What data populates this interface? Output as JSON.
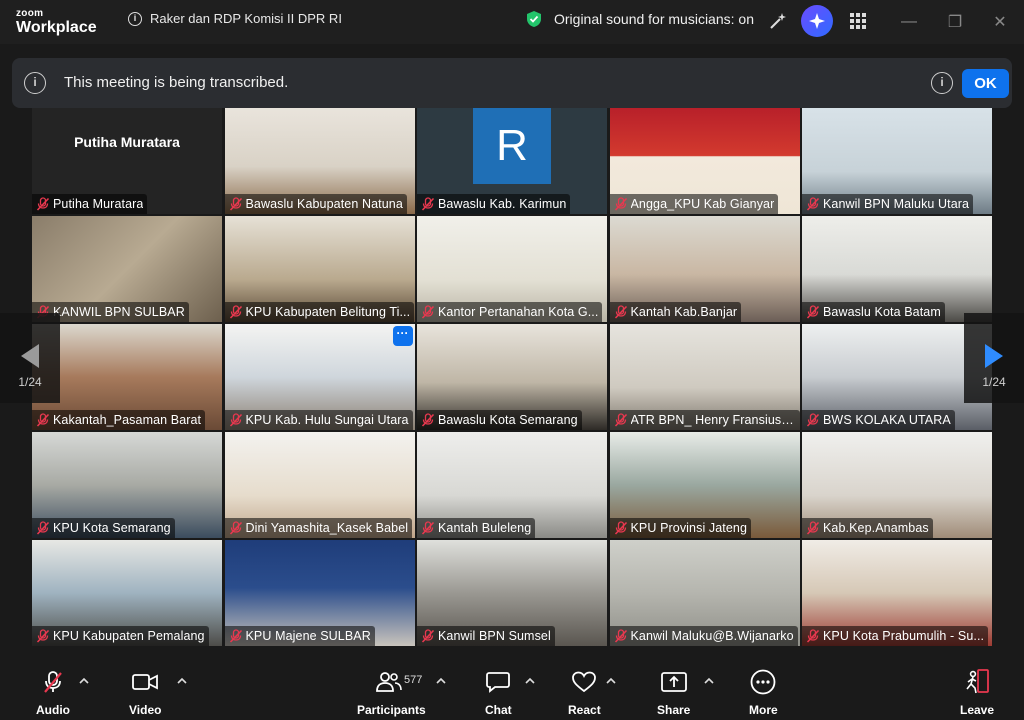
{
  "app": {
    "brand_top": "zoom",
    "brand_bottom": "Workplace"
  },
  "meeting": {
    "title": "Raker dan RDP Komisi II DPR RI"
  },
  "sound": {
    "text": "Original sound for musicians: on"
  },
  "banner": {
    "message": "This meeting is being transcribed.",
    "ok_label": "OK"
  },
  "pager": {
    "left_page": "1/24",
    "right_page": "1/24"
  },
  "tiles": [
    {
      "name": "Putiha Muratara",
      "center": "Putiha Muratara"
    },
    {
      "name": "Bawaslu Kabupaten Natuna"
    },
    {
      "name": "Bawaslu Kab. Karimun",
      "avatar": "R"
    },
    {
      "name": "Angga_KPU Kab Gianyar"
    },
    {
      "name": "Kanwil BPN Maluku Utara"
    },
    {
      "name": "KANWIL BPN SULBAR"
    },
    {
      "name": "KPU Kabupaten Belitung Ti..."
    },
    {
      "name": "Kantor Pertanahan Kota G..."
    },
    {
      "name": "Kantah Kab.Banjar"
    },
    {
      "name": "Bawaslu Kota Batam"
    },
    {
      "name": "Kakantah_Pasaman Barat"
    },
    {
      "name": "KPU Kab. Hulu Sungai Utara"
    },
    {
      "name": "Bawaslu Kota Semarang"
    },
    {
      "name": "ATR BPN_ Henry Fransius P..."
    },
    {
      "name": "BWS KOLAKA UTARA"
    },
    {
      "name": "KPU Kota Semarang"
    },
    {
      "name": "Dini Yamashita_Kasek Babel"
    },
    {
      "name": "Kantah Buleleng"
    },
    {
      "name": "KPU Provinsi Jateng"
    },
    {
      "name": "Kab.Kep.Anambas"
    },
    {
      "name": "KPU Kabupaten Pemalang"
    },
    {
      "name": "KPU Majene SULBAR"
    },
    {
      "name": "Kanwil BPN Sumsel"
    },
    {
      "name": "Kanwil Maluku@B.Wijanarko"
    },
    {
      "name": "KPU Kota Prabumulih - Su..."
    }
  ],
  "toolbar": {
    "audio": "Audio",
    "video": "Video",
    "participants": "Participants",
    "participants_count": "577",
    "chat": "Chat",
    "react": "React",
    "share": "Share",
    "more": "More",
    "leave": "Leave"
  }
}
